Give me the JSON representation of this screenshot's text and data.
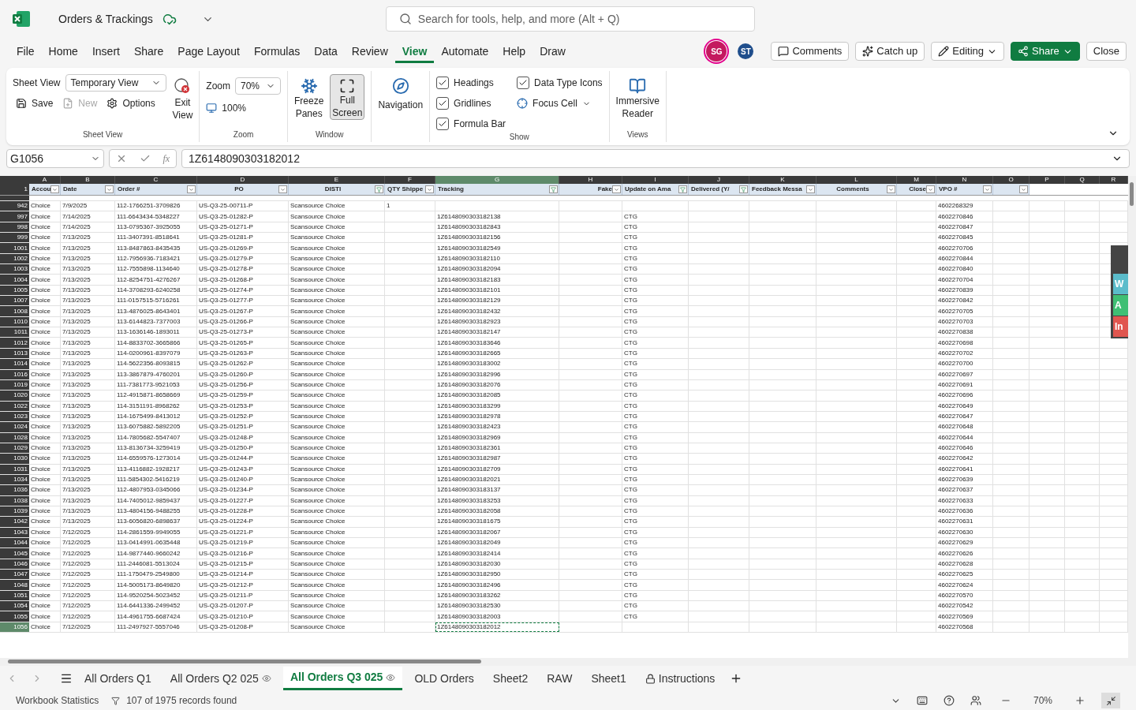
{
  "title_bar": {
    "file_name": "Orders & Trackings",
    "search": {
      "placeholder": "Search for tools, help, and more (Alt + Q)"
    },
    "avatars": [
      {
        "initials": "SG",
        "color": "#c4195f"
      },
      {
        "initials": "ST",
        "color": "#1f4e8c"
      }
    ],
    "buttons": [
      {
        "kind": "comments",
        "label": "Comments"
      },
      {
        "kind": "catchup",
        "label": "Catch up"
      },
      {
        "kind": "editing",
        "label": "Editing"
      },
      {
        "kind": "share",
        "label": "Share"
      },
      {
        "kind": "plain",
        "label": "Close"
      }
    ]
  },
  "menu_tabs": [
    {
      "label": "File",
      "selected": false
    },
    {
      "label": "Home",
      "selected": false
    },
    {
      "label": "Insert",
      "selected": false
    },
    {
      "label": "Share",
      "selected": false
    },
    {
      "label": "Page Layout",
      "selected": false
    },
    {
      "label": "Formulas",
      "selected": false
    },
    {
      "label": "Data",
      "selected": false
    },
    {
      "label": "Review",
      "selected": false
    },
    {
      "label": "View",
      "selected": true
    },
    {
      "label": "Automate",
      "selected": false
    },
    {
      "label": "Help",
      "selected": false
    },
    {
      "label": "Draw",
      "selected": false
    }
  ],
  "ribbon": {
    "sheet_view": {
      "label": "Sheet View",
      "select": "Temporary View",
      "save": "Save",
      "new": {
        "label": "New",
        "disabled": true
      },
      "options": "Options",
      "exit": [
        "Exit",
        "View"
      ],
      "group": "Sheet View"
    },
    "zoom": {
      "label": "Zoom",
      "select": "70%",
      "reset": "100%",
      "group": "Zoom"
    },
    "window": {
      "freeze": [
        "Freeze",
        "Panes"
      ],
      "full_screen": {
        "label": [
          "Full",
          "Screen"
        ],
        "selected": true
      },
      "group": "Window"
    },
    "navigation": "Navigation",
    "show": {
      "checks": [
        {
          "label": "Headings",
          "checked": true
        },
        {
          "label": "Gridlines",
          "checked": true
        },
        {
          "label": "Formula Bar",
          "checked": true
        },
        {
          "label": "Data Type Icons",
          "checked": true
        }
      ],
      "focus_cell": "Focus Cell",
      "group": "Show"
    },
    "views": {
      "reader": [
        "Immersive",
        "Reader"
      ],
      "group": "Views"
    }
  },
  "formula_bar": {
    "name_box": "G1056",
    "function_label": "fx",
    "value": "1Z6148090303182012"
  },
  "sheet": {
    "column_letters": [
      {
        "label": "A",
        "selected": false
      },
      {
        "label": "B",
        "selected": false
      },
      {
        "label": "C",
        "selected": false
      },
      {
        "label": "D",
        "selected": false
      },
      {
        "label": "E",
        "selected": false
      },
      {
        "label": "F",
        "selected": false
      },
      {
        "label": "G",
        "selected": true
      },
      {
        "label": "H",
        "selected": false
      },
      {
        "label": "I",
        "selected": false
      },
      {
        "label": "J",
        "selected": false
      },
      {
        "label": "K",
        "selected": false
      },
      {
        "label": "L",
        "selected": false
      },
      {
        "label": "M",
        "selected": false
      },
      {
        "label": "N",
        "selected": false
      },
      {
        "label": "O",
        "selected": false
      },
      {
        "label": "P",
        "selected": false
      },
      {
        "label": "Q",
        "selected": false
      },
      {
        "label": "R",
        "selected": false
      }
    ],
    "header_row": "1",
    "headers": [
      {
        "label": "Accou",
        "filtered": false
      },
      {
        "label": "Date",
        "filtered": false
      },
      {
        "label": "Order #",
        "filtered": false
      },
      {
        "label": "PO",
        "filtered": false
      },
      {
        "label": "DISTI",
        "filtered": true
      },
      {
        "label": "QTY Shippe",
        "filtered": false
      },
      {
        "label": "Tracking",
        "filtered": true
      },
      {
        "label": "Fake",
        "filtered": false
      },
      {
        "label": "Update on Ama",
        "filtered": true
      },
      {
        "label": "Delivered (Y/",
        "filtered": true
      },
      {
        "label": "Feedback Messa",
        "filtered": false
      },
      {
        "label": "Comments",
        "filtered": false
      },
      {
        "label": "Close",
        "filtered": false
      },
      {
        "label": "VPO #",
        "filtered": false
      },
      {
        "filtered": false
      }
    ],
    "rows": [
      {
        "row": "942",
        "selected": false,
        "account": "Choice",
        "date": "7/9/2025",
        "order": "112-1766251-3709826",
        "po": "US-Q3-25-00711-P",
        "disti": "Scansource Choice",
        "qty": "1",
        "vpo": "4602268329"
      },
      {
        "row": "997",
        "selected": false,
        "account": "Choice",
        "date": "7/14/2025",
        "order": "111-6643434-5348227",
        "po": "US-Q3-25-01282-P",
        "disti": "Scansource Choice",
        "tracking": "1Z6148090303182138",
        "update": "CTG",
        "vpo": "4602270846"
      },
      {
        "row": "998",
        "selected": false,
        "account": "Choice",
        "date": "7/14/2025",
        "order": "113-0795367-3925055",
        "po": "US-Q3-25-01271-P",
        "disti": "Scansource Choice",
        "tracking": "1Z6148090303182843",
        "update": "CTG",
        "vpo": "4602270847"
      },
      {
        "row": "999",
        "selected": false,
        "account": "Choice",
        "date": "7/13/2025",
        "order": "111-3407391-8518641",
        "po": "US-Q3-25-01281-P",
        "disti": "Scansource Choice",
        "tracking": "1Z6148090303182156",
        "update": "CTG",
        "vpo": "4602270845"
      },
      {
        "row": "1001",
        "selected": false,
        "account": "Choice",
        "date": "7/13/2025",
        "order": "113-8487863-8435435",
        "po": "US-Q3-25-01269-P",
        "disti": "Scansource Choice",
        "tracking": "1Z6148090303182549",
        "update": "CTG",
        "vpo": "4602270706"
      },
      {
        "row": "1002",
        "selected": false,
        "account": "Choice",
        "date": "7/13/2025",
        "order": "112-7956936-7183421",
        "po": "US-Q3-25-01279-P",
        "disti": "Scansource Choice",
        "tracking": "1Z6148090303182110",
        "update": "CTG",
        "vpo": "4602270844"
      },
      {
        "row": "1003",
        "selected": false,
        "account": "Choice",
        "date": "7/13/2025",
        "order": "112-7555898-1134640",
        "po": "US-Q3-25-01278-P",
        "disti": "Scansource Choice",
        "tracking": "1Z6148090303182094",
        "update": "CTG",
        "vpo": "4602270840"
      },
      {
        "row": "1004",
        "selected": false,
        "account": "Choice",
        "date": "7/13/2025",
        "order": "112-8254751-4276267",
        "po": "US-Q3-25-01268-P",
        "disti": "Scansource Choice",
        "tracking": "1Z6148090303182183",
        "update": "CTG",
        "vpo": "4602270704"
      },
      {
        "row": "1005",
        "selected": false,
        "account": "Choice",
        "date": "7/13/2025",
        "order": "114-3708293-6240258",
        "po": "US-Q3-25-01274-P",
        "disti": "Scansource Choice",
        "tracking": "1Z6148090303182101",
        "update": "CTG",
        "vpo": "4602270839"
      },
      {
        "row": "1007",
        "selected": false,
        "account": "Choice",
        "date": "7/13/2025",
        "order": "111-0157515-5716261",
        "po": "US-Q3-25-01277-P",
        "disti": "Scansource Choice",
        "tracking": "1Z6148090303182129",
        "update": "CTG",
        "vpo": "4602270842"
      },
      {
        "row": "1008",
        "selected": false,
        "account": "Choice",
        "date": "7/13/2025",
        "order": "113-4876025-8643401",
        "po": "US-Q3-25-01267-P",
        "disti": "Scansource Choice",
        "tracking": "1Z6148090303182432",
        "update": "CTG",
        "vpo": "4602270705"
      },
      {
        "row": "1010",
        "selected": false,
        "account": "Choice",
        "date": "7/13/2025",
        "order": "113-6144823-7377003",
        "po": "US-Q3-25-01266-P",
        "disti": "Scansource Choice",
        "tracking": "1Z6148090303182923",
        "update": "CTG",
        "vpo": "4602270703"
      },
      {
        "row": "1011",
        "selected": false,
        "account": "Choice",
        "date": "7/13/2025",
        "order": "113-1636146-1893011",
        "po": "US-Q3-25-01273-P",
        "disti": "Scansource Choice",
        "tracking": "1Z6148090303182147",
        "update": "CTG",
        "vpo": "4602270838"
      },
      {
        "row": "1012",
        "selected": false,
        "account": "Choice",
        "date": "7/13/2025",
        "order": "114-8833702-3665866",
        "po": "US-Q3-25-01265-P",
        "disti": "Scansource Choice",
        "tracking": "1Z6148090303183646",
        "update": "CTG",
        "vpo": "4602270698"
      },
      {
        "row": "1013",
        "selected": false,
        "account": "Choice",
        "date": "7/13/2025",
        "order": "114-0200961-8397079",
        "po": "US-Q3-25-01263-P",
        "disti": "Scansource Choice",
        "tracking": "1Z6148090303182665",
        "update": "CTG",
        "vpo": "4602270702"
      },
      {
        "row": "1014",
        "selected": false,
        "account": "Choice",
        "date": "7/13/2025",
        "order": "114-5622356-8093815",
        "po": "US-Q3-25-01262-P",
        "disti": "Scansource Choice",
        "tracking": "1Z6148090303183002",
        "update": "CTG",
        "vpo": "4602270700"
      },
      {
        "row": "1016",
        "selected": false,
        "account": "Choice",
        "date": "7/13/2025",
        "order": "113-3867879-4760201",
        "po": "US-Q3-25-01260-P",
        "disti": "Scansource Choice",
        "tracking": "1Z6148090303182996",
        "update": "CTG",
        "vpo": "4602270697"
      },
      {
        "row": "1019",
        "selected": false,
        "account": "Choice",
        "date": "7/13/2025",
        "order": "111-7381773-9521053",
        "po": "US-Q3-25-01256-P",
        "disti": "Scansource Choice",
        "tracking": "1Z6148090303182076",
        "update": "CTG",
        "vpo": "4602270691"
      },
      {
        "row": "1020",
        "selected": false,
        "account": "Choice",
        "date": "7/13/2025",
        "order": "112-4915871-8658669",
        "po": "US-Q3-25-01259-P",
        "disti": "Scansource Choice",
        "tracking": "1Z6148090303182085",
        "update": "CTG",
        "vpo": "4602270696"
      },
      {
        "row": "1022",
        "selected": false,
        "account": "Choice",
        "date": "7/13/2025",
        "order": "114-3151191-8968262",
        "po": "US-Q3-25-01253-P",
        "disti": "Scansource Choice",
        "tracking": "1Z6148090303183299",
        "update": "CTG",
        "vpo": "4602270649"
      },
      {
        "row": "1023",
        "selected": false,
        "account": "Choice",
        "date": "7/13/2025",
        "order": "114-1675499-8413012",
        "po": "US-Q3-25-01252-P",
        "disti": "Scansource Choice",
        "tracking": "1Z6148090303182978",
        "update": "CTG",
        "vpo": "4602270647"
      },
      {
        "row": "1024",
        "selected": false,
        "account": "Choice",
        "date": "7/13/2025",
        "order": "113-6075882-5892205",
        "po": "US-Q3-25-01251-P",
        "disti": "Scansource Choice",
        "tracking": "1Z6148090303182423",
        "update": "CTG",
        "vpo": "4602270648"
      },
      {
        "row": "1028",
        "selected": false,
        "account": "Choice",
        "date": "7/13/2025",
        "order": "114-7805682-5547407",
        "po": "US-Q3-25-01248-P",
        "disti": "Scansource Choice",
        "tracking": "1Z6148090303182969",
        "update": "CTG",
        "vpo": "4602270644"
      },
      {
        "row": "1029",
        "selected": false,
        "account": "Choice",
        "date": "7/13/2025",
        "order": "113-8136734-3259419",
        "po": "US-Q3-25-01250-P",
        "disti": "Scansource Choice",
        "tracking": "1Z6148090303182361",
        "update": "CTG",
        "vpo": "4602270646"
      },
      {
        "row": "1030",
        "selected": false,
        "account": "Choice",
        "date": "7/13/2025",
        "order": "114-6559576-1273014",
        "po": "US-Q3-25-01244-P",
        "disti": "Scansource Choice",
        "tracking": "1Z6148090303182987",
        "update": "CTG",
        "vpo": "4602270642"
      },
      {
        "row": "1031",
        "selected": false,
        "account": "Choice",
        "date": "7/13/2025",
        "order": "113-4116882-1928217",
        "po": "US-Q3-25-01243-P",
        "disti": "Scansource Choice",
        "tracking": "1Z6148090303182709",
        "update": "CTG",
        "vpo": "4602270641"
      },
      {
        "row": "1034",
        "selected": false,
        "account": "Choice",
        "date": "7/13/2025",
        "order": "111-5854302-5416219",
        "po": "US-Q3-25-01240-P",
        "disti": "Scansource Choice",
        "tracking": "1Z6148090303182021",
        "update": "CTG",
        "vpo": "4602270639"
      },
      {
        "row": "1036",
        "selected": false,
        "account": "Choice",
        "date": "7/13/2025",
        "order": "112-4807953-0345066",
        "po": "US-Q3-25-01234-P",
        "disti": "Scansource Choice",
        "tracking": "1Z6148090303183137",
        "update": "CTG",
        "vpo": "4602270637"
      },
      {
        "row": "1038",
        "selected": false,
        "account": "Choice",
        "date": "7/13/2025",
        "order": "114-7405012-9859437",
        "po": "US-Q3-25-01227-P",
        "disti": "Scansource Choice",
        "tracking": "1Z6148090303183253",
        "update": "CTG",
        "vpo": "4602270633"
      },
      {
        "row": "1039",
        "selected": false,
        "account": "Choice",
        "date": "7/13/2025",
        "order": "113-4804156-9488255",
        "po": "US-Q3-25-01228-P",
        "disti": "Scansource Choice",
        "tracking": "1Z6148090303182058",
        "update": "CTG",
        "vpo": "4602270636"
      },
      {
        "row": "1042",
        "selected": false,
        "account": "Choice",
        "date": "7/13/2025",
        "order": "113-6056820-6898637",
        "po": "US-Q3-25-01224-P",
        "disti": "Scansource Choice",
        "tracking": "1Z6148090303181675",
        "update": "CTG",
        "vpo": "4602270631"
      },
      {
        "row": "1043",
        "selected": false,
        "account": "Choice",
        "date": "7/12/2025",
        "order": "114-2861559-9949055",
        "po": "US-Q3-25-01221-P",
        "disti": "Scansource Choice",
        "tracking": "1Z6148090303182067",
        "update": "CTG",
        "vpo": "4602270630"
      },
      {
        "row": "1044",
        "selected": false,
        "account": "Choice",
        "date": "7/12/2025",
        "order": "113-0414991-0635448",
        "po": "US-Q3-25-01219-P",
        "disti": "Scansource Choice",
        "tracking": "1Z6148090303182049",
        "update": "CTG",
        "vpo": "4602270629"
      },
      {
        "row": "1045",
        "selected": false,
        "account": "Choice",
        "date": "7/12/2025",
        "order": "114-9877440-9660242",
        "po": "US-Q3-25-01216-P",
        "disti": "Scansource Choice",
        "tracking": "1Z6148090303182414",
        "update": "CTG",
        "vpo": "4602270626"
      },
      {
        "row": "1046",
        "selected": false,
        "account": "Choice",
        "date": "7/12/2025",
        "order": "111-2446081-5513024",
        "po": "US-Q3-25-01215-P",
        "disti": "Scansource Choice",
        "tracking": "1Z6148090303182030",
        "update": "CTG",
        "vpo": "4602270628"
      },
      {
        "row": "1047",
        "selected": false,
        "account": "Choice",
        "date": "7/12/2025",
        "order": "111-1750479-2549800",
        "po": "US-Q3-25-01214-P",
        "disti": "Scansource Choice",
        "tracking": "1Z6148090303182950",
        "update": "CTG",
        "vpo": "4602270625"
      },
      {
        "row": "1048",
        "selected": false,
        "account": "Choice",
        "date": "7/12/2025",
        "order": "114-5005173-8649820",
        "po": "US-Q3-25-01212-P",
        "disti": "Scansource Choice",
        "tracking": "1Z6148090303182496",
        "update": "CTG",
        "vpo": "4602270624"
      },
      {
        "row": "1051",
        "selected": false,
        "account": "Choice",
        "date": "7/12/2025",
        "order": "114-9520254-5023452",
        "po": "US-Q3-25-01211-P",
        "disti": "Scansource Choice",
        "tracking": "1Z6148090303183262",
        "update": "CTG",
        "vpo": "4602270570"
      },
      {
        "row": "1054",
        "selected": false,
        "account": "Choice",
        "date": "7/12/2025",
        "order": "114-6441336-2499452",
        "po": "US-Q3-25-01207-P",
        "disti": "Scansource Choice",
        "tracking": "1Z6148090303182530",
        "update": "CTG",
        "vpo": "4602270542"
      },
      {
        "row": "1055",
        "selected": false,
        "account": "Choice",
        "date": "7/12/2025",
        "order": "114-4961755-6687424",
        "po": "US-Q3-25-01210-P",
        "disti": "Scansource Choice",
        "tracking": "1Z6148090303182003",
        "update": "CTG",
        "vpo": "4602270569"
      },
      {
        "row": "1056",
        "selected": true,
        "account": "Choice",
        "date": "7/12/2025",
        "order": "111-2497927-5557046",
        "po": "US-Q3-25-01208-P",
        "disti": "Scansource Choice",
        "tracking": "1Z6148090303182012",
        "vpo": "4602270568"
      }
    ]
  },
  "side_panel": [
    {
      "label": "W",
      "color": "#5bbccb"
    },
    {
      "label": "A",
      "color": "#3fbf74"
    },
    {
      "label": "In",
      "color": "#e0564f"
    }
  ],
  "sheet_tabs": [
    {
      "label": "All Orders Q1",
      "selected": false,
      "kind": "plain"
    },
    {
      "label": "All Orders Q2 025",
      "selected": false,
      "kind": "viewed"
    },
    {
      "label": "All Orders Q3 025",
      "selected": true,
      "kind": "viewed"
    },
    {
      "label": "OLD Orders",
      "selected": false,
      "kind": "plain"
    },
    {
      "label": "Sheet2",
      "selected": false,
      "kind": "plain"
    },
    {
      "label": "RAW",
      "selected": false,
      "kind": "plain"
    },
    {
      "label": "Sheet1",
      "selected": false,
      "kind": "plain"
    },
    {
      "label": "Instructions",
      "selected": false,
      "kind": "protected"
    }
  ],
  "status_bar": {
    "stats": "Workbook Statistics",
    "filter": "107 of 1975 records found",
    "zoom": "70%"
  }
}
